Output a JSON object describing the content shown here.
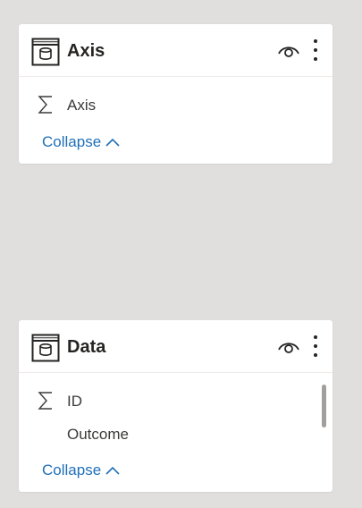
{
  "cards": [
    {
      "title": "Axis",
      "fields": [
        {
          "label": "Axis",
          "icon": "sigma-icon"
        }
      ],
      "collapse_label": "Collapse"
    },
    {
      "title": "Data",
      "fields": [
        {
          "label": "ID",
          "icon": "sigma-icon"
        },
        {
          "label": "Outcome",
          "icon": null
        }
      ],
      "collapse_label": "Collapse"
    }
  ],
  "colors": {
    "background": "#e1dfdd",
    "card": "#ffffff",
    "link": "#1f6fb8",
    "text": "#252423"
  }
}
